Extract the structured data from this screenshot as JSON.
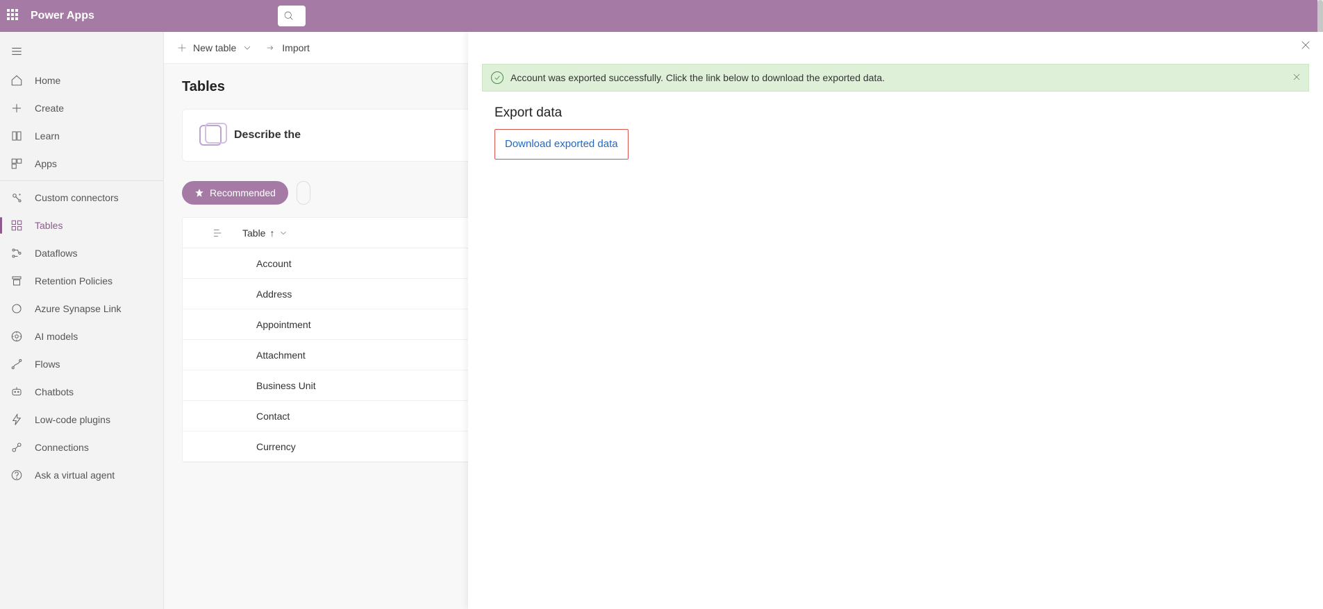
{
  "header": {
    "app_name": "Power Apps"
  },
  "sidebar": {
    "items": [
      {
        "label": "Home"
      },
      {
        "label": "Create"
      },
      {
        "label": "Learn"
      },
      {
        "label": "Apps"
      },
      {
        "label": "Custom connectors"
      },
      {
        "label": "Tables"
      },
      {
        "label": "Dataflows"
      },
      {
        "label": "Retention Policies"
      },
      {
        "label": "Azure Synapse Link"
      },
      {
        "label": "AI models"
      },
      {
        "label": "Flows"
      },
      {
        "label": "Chatbots"
      },
      {
        "label": "Low-code plugins"
      },
      {
        "label": "Connections"
      },
      {
        "label": "Ask a virtual agent"
      }
    ]
  },
  "toolbar": {
    "new_table": "New table",
    "import": "Import"
  },
  "page": {
    "title": "Tables",
    "describe_card": "Describe the",
    "recommended": "Recommended",
    "table_header": "Table",
    "rows": [
      "Account",
      "Address",
      "Appointment",
      "Attachment",
      "Business Unit",
      "Contact",
      "Currency"
    ]
  },
  "panel": {
    "success_message": "Account was exported successfully. Click the link below to download the exported data.",
    "heading": "Export data",
    "download_link": "Download exported data"
  }
}
